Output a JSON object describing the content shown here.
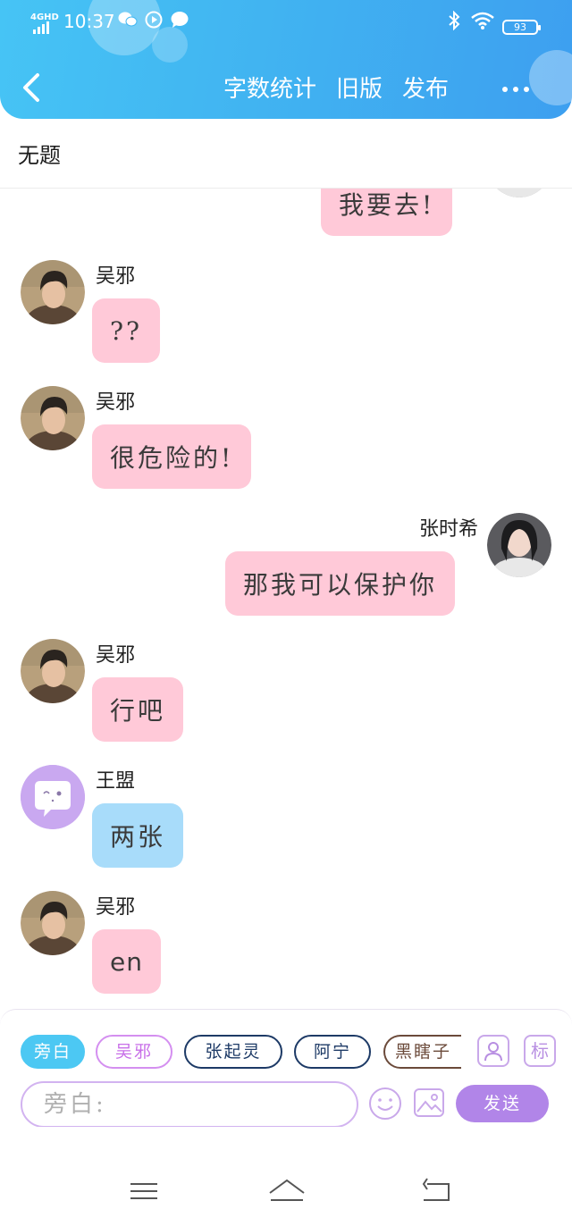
{
  "status_bar": {
    "network": "4GHD",
    "time": "10:37",
    "battery": "93"
  },
  "header": {
    "actions": [
      "字数统计",
      "旧版",
      "发布"
    ]
  },
  "title": "无题",
  "messages": [
    {
      "name": "",
      "text": "我要去!",
      "side": "right",
      "color": "pink"
    },
    {
      "name": "吴邪",
      "text": "??",
      "side": "left",
      "color": "pink"
    },
    {
      "name": "吴邪",
      "text": "很危险的!",
      "side": "left",
      "color": "pink"
    },
    {
      "name": "张时希",
      "text": "那我可以保护你",
      "side": "right",
      "color": "pink"
    },
    {
      "name": "吴邪",
      "text": "行吧",
      "side": "left",
      "color": "pink"
    },
    {
      "name": "王盟",
      "text": "两张",
      "side": "left",
      "color": "blue"
    },
    {
      "name": "吴邪",
      "text": "en",
      "side": "left",
      "color": "pink"
    }
  ],
  "input_area": {
    "chips": [
      "旁白",
      "吴邪",
      "张起灵",
      "阿宁",
      "黑瞎子"
    ],
    "mark_button": "标",
    "placeholder": "旁白:",
    "send_label": "发送"
  },
  "colors": {
    "header_gradient_start": "#46c4f5",
    "header_gradient_end": "#3d9ff0",
    "bubble_pink": "#ffc9d8",
    "bubble_blue": "#a8dcfa",
    "send_button": "#b185e8",
    "chip_active": "#4cc8f3"
  }
}
